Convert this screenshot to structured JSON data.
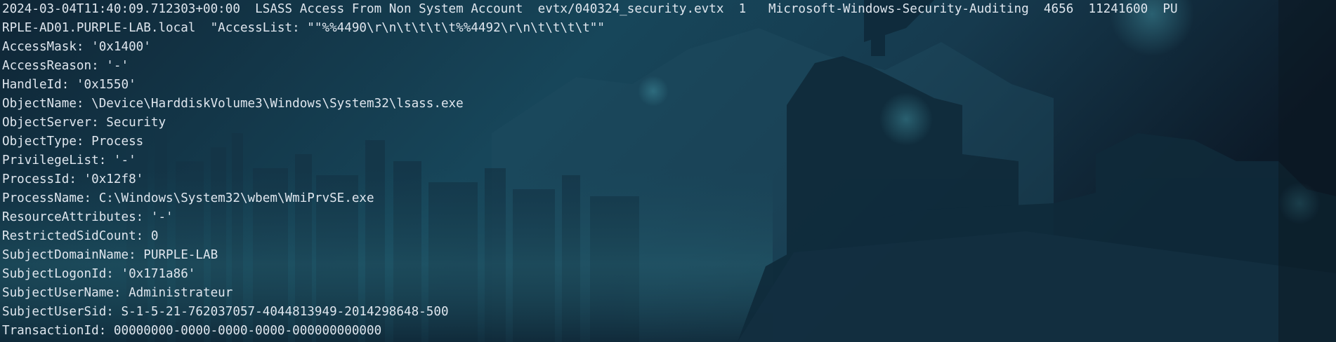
{
  "terminal": {
    "lines": [
      "2024-03-04T11:40:09.712303+00:00  LSASS Access From Non System Account  evtx/040324_security.evtx  1   Microsoft-Windows-Security-Auditing  4656  11241600  PU",
      "RPLE-AD01.PURPLE-LAB.local  \"AccessList: \"\"%%4490\\r\\n\\t\\t\\t\\t%%4492\\r\\n\\t\\t\\t\\t\"\"",
      "AccessMask: '0x1400'",
      "AccessReason: '-'",
      "HandleId: '0x1550'",
      "ObjectName: \\Device\\HarddiskVolume3\\Windows\\System32\\lsass.exe",
      "ObjectServer: Security",
      "ObjectType: Process",
      "PrivilegeList: '-'",
      "ProcessId: '0x12f8'",
      "ProcessName: C:\\Windows\\System32\\wbem\\WmiPrvSE.exe",
      "ResourceAttributes: '-'",
      "RestrictedSidCount: 0",
      "SubjectDomainName: PURPLE-LAB",
      "SubjectLogonId: '0x171a86'",
      "SubjectUserName: Administrateur",
      "SubjectUserSid: S-1-5-21-762037057-4044813949-2014298648-500",
      "TransactionId: 00000000-0000-0000-0000-000000000000"
    ]
  },
  "theme": {
    "background": "#0f2232",
    "text": "#dfe6ee"
  }
}
